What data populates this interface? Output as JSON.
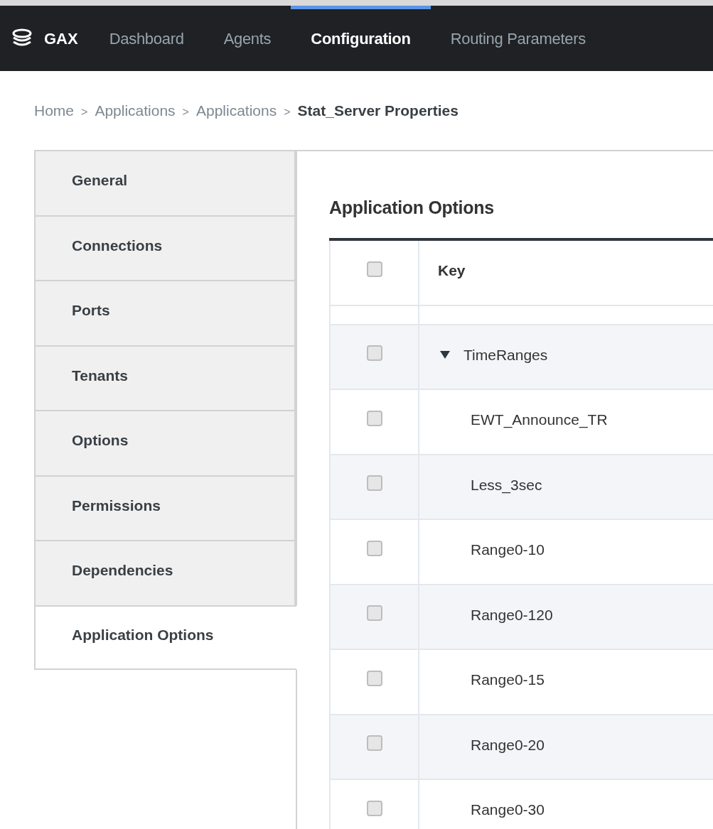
{
  "nav": {
    "brand": "GAX",
    "items": [
      {
        "label": "Dashboard",
        "selected": false
      },
      {
        "label": "Agents",
        "selected": false
      },
      {
        "label": "Configuration",
        "selected": true
      },
      {
        "label": "Routing Parameters",
        "selected": false
      }
    ]
  },
  "breadcrumb": [
    {
      "label": "Home",
      "current": false,
      "separator": ">"
    },
    {
      "label": "Applications",
      "current": false,
      "separator": ">"
    },
    {
      "label": "Applications",
      "current": false,
      "separator": ">"
    },
    {
      "label": "Stat_Server Properties",
      "current": true
    }
  ],
  "sidebar": {
    "items": [
      {
        "label": "General",
        "selected": false
      },
      {
        "label": "Connections",
        "selected": false
      },
      {
        "label": "Ports",
        "selected": false
      },
      {
        "label": "Tenants",
        "selected": false
      },
      {
        "label": "Options",
        "selected": false
      },
      {
        "label": "Permissions",
        "selected": false
      },
      {
        "label": "Dependencies",
        "selected": false
      },
      {
        "label": "Application Options",
        "selected": true
      }
    ]
  },
  "content": {
    "title": "Application Options",
    "table": {
      "header_checked": false,
      "columns": [
        {
          "label": "Key"
        }
      ],
      "rows": [
        {
          "key": "TimeRanges",
          "checked": false,
          "expanded": true,
          "children": [
            {
              "key": "EWT_Announce_TR",
              "checked": false
            },
            {
              "key": "Less_3sec",
              "checked": false
            },
            {
              "key": "Range0-10",
              "checked": false
            },
            {
              "key": "Range0-120",
              "checked": false
            },
            {
              "key": "Range0-15",
              "checked": false
            },
            {
              "key": "Range0-20",
              "checked": false
            },
            {
              "key": "Range0-30",
              "checked": false
            }
          ]
        }
      ]
    }
  }
}
